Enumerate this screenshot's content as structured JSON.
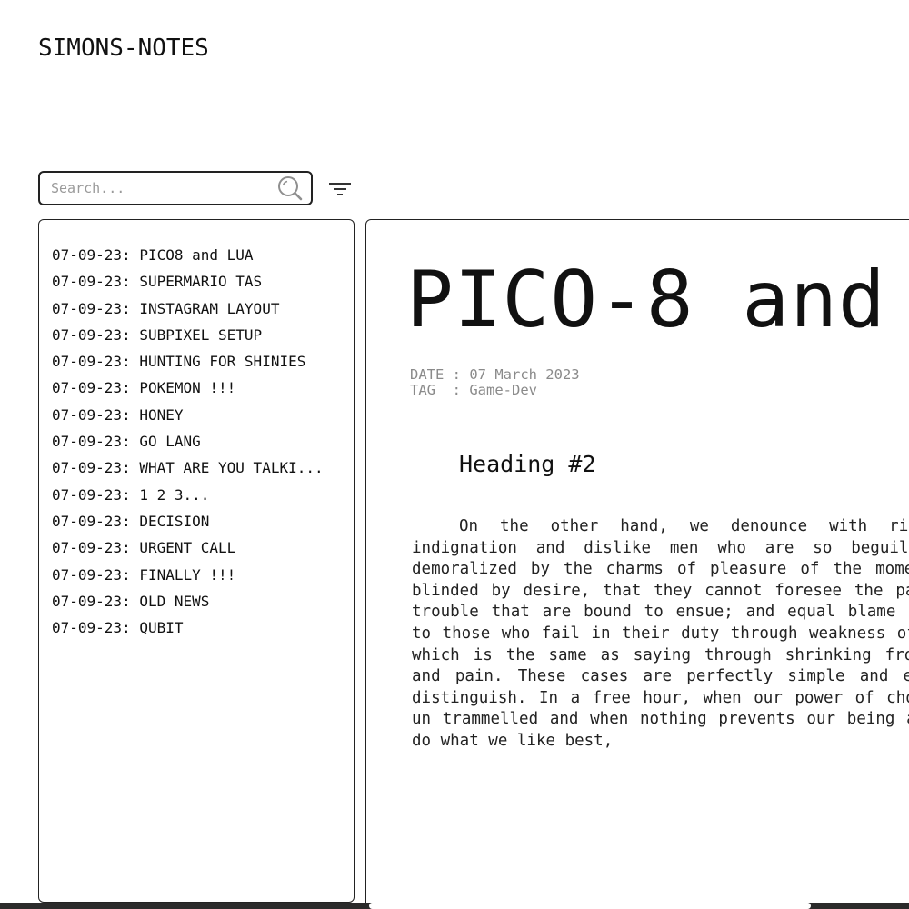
{
  "header": {
    "site_title": "SIMONS-NOTES"
  },
  "search": {
    "placeholder": "Search...",
    "value": ""
  },
  "icons": {
    "search": "search-icon",
    "filter": "filter-icon"
  },
  "notes": [
    {
      "label": "07-09-23: PICO8 and LUA"
    },
    {
      "label": "07-09-23: SUPERMARIO TAS"
    },
    {
      "label": "07-09-23: INSTAGRAM LAYOUT"
    },
    {
      "label": "07-09-23: SUBPIXEL SETUP"
    },
    {
      "label": "07-09-23: HUNTING FOR SHINIES"
    },
    {
      "label": "07-09-23: POKEMON !!!"
    },
    {
      "label": "07-09-23: HONEY"
    },
    {
      "label": "07-09-23: GO LANG"
    },
    {
      "label": "07-09-23: WHAT ARE YOU TALKI..."
    },
    {
      "label": "07-09-23: 1 2 3..."
    },
    {
      "label": "07-09-23: DECISION"
    },
    {
      "label": "07-09-23: URGENT CALL"
    },
    {
      "label": "07-09-23: FINALLY !!!"
    },
    {
      "label": "07-09-23: OLD NEWS"
    },
    {
      "label": "07-09-23: QUBIT"
    }
  ],
  "article": {
    "title": "PICO-8 and",
    "date_line": "DATE : 07 March 2023",
    "tag_line": "TAG  : Game-Dev",
    "heading": "Heading #2",
    "paragraph": "On the other hand, we denounce with righteous indignation and dislike men who are so beguiled and demoralized by the charms of pleasure of the moment, so blinded by desire, that they cannot foresee the pain and trouble that are bound to ensue; and equal blame belongs to those who fail in their duty through weakness of will, which is the same as saying through shrinking from toil and pain. These cases are perfectly simple and easy to distinguish. In a free hour, when our power of choice is un trammelled and when nothing prevents our being able to do what we like best,"
  }
}
